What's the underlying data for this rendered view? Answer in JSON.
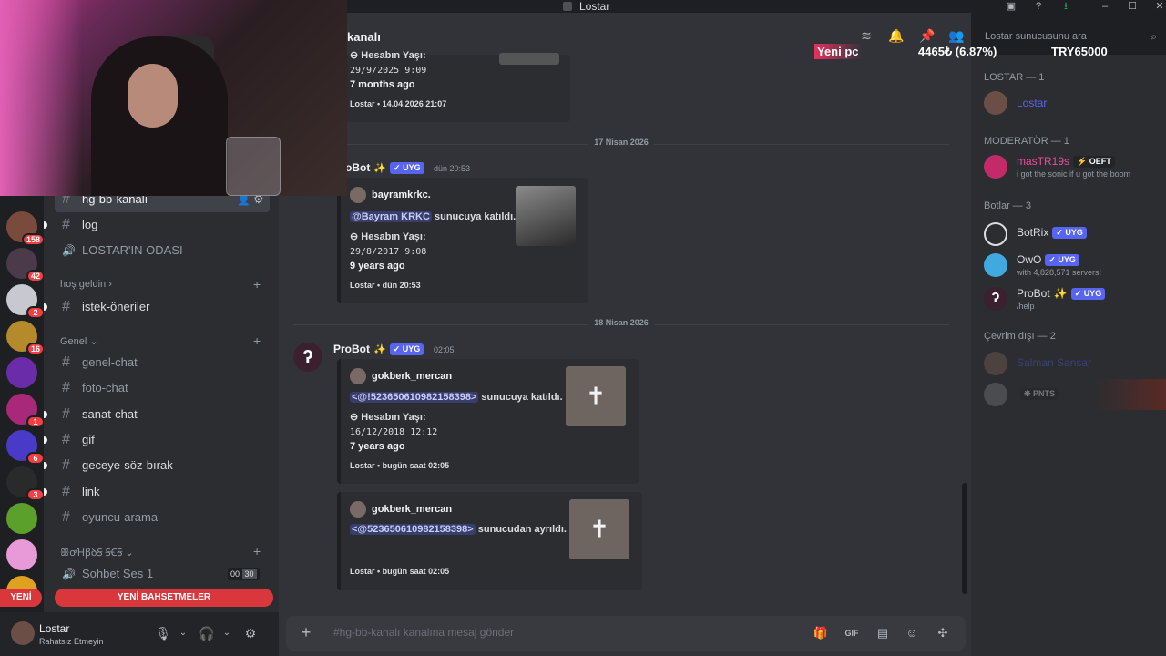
{
  "window": {
    "title": "Lostar"
  },
  "server_rail": {
    "badges": [
      "11",
      "158",
      "42",
      "2",
      "16",
      "1",
      "6",
      "3"
    ]
  },
  "sidebar": {
    "channels_top": [
      {
        "name": "hg-bb-kanalı",
        "type": "text",
        "selected": true
      },
      {
        "name": "log",
        "type": "text"
      },
      {
        "name": "LOSTAR'IN ODASI",
        "type": "voice"
      }
    ],
    "category_welcome": "hoş geldin",
    "channels_welcome": [
      {
        "name": "istek-öneriler",
        "type": "text",
        "unread": true
      }
    ],
    "category_general": "Genel",
    "channels_general": [
      {
        "name": "genel-chat",
        "type": "text",
        "muted": true
      },
      {
        "name": "foto-chat",
        "type": "text",
        "muted": true
      },
      {
        "name": "sanat-chat",
        "type": "text",
        "unread": true
      },
      {
        "name": "gif",
        "type": "text",
        "unread": true
      },
      {
        "name": "geceye-söz-bırak",
        "type": "text",
        "unread": true
      },
      {
        "name": "link",
        "type": "text",
        "unread": true
      },
      {
        "name": "oyuncu-arama",
        "type": "text",
        "muted": true
      }
    ],
    "category_voice": "ꕥꝍꞪꞵꝺꞨ ꞨꞒꞨ",
    "voice_channel": {
      "name": "Sohbet Ses 1",
      "count": "00",
      "limit": "30"
    },
    "new_mentions": "YENİ BAHSETMELER",
    "new_badge": "YENİ"
  },
  "user_panel": {
    "name": "Lostar",
    "status": "Rahatsız Etmeyin"
  },
  "header": {
    "channel": "kanalı",
    "search_placeholder": "Lostar sunucusunu ara"
  },
  "messages": {
    "embed0": {
      "account_age_label": "Hesabın Yaşı:",
      "date": "29/9/2025 9:09",
      "ago": "7 months ago",
      "footer": "Lostar • 14.04.2026 21:07"
    },
    "divider1": "17 Nisan 2026",
    "msg1": {
      "author": "oBot",
      "tag": "UYG",
      "time": "dün 20:53",
      "embed": {
        "user": "bayramkrkc.",
        "mention": "@Bayram KRKC",
        "action": "sunucuya katıldı.",
        "account_age_label": "Hesabın Yaşı:",
        "date": "29/8/2017 9:08",
        "ago": "9 years ago",
        "footer": "Lostar • dün 20:53"
      }
    },
    "divider2": "18 Nisan 2026",
    "msg2": {
      "author": "ProBot",
      "tag": "UYG",
      "time": "02:05",
      "embed": {
        "user": "gokberk_mercan",
        "mention": "<@!523650610982158398>",
        "action": "sunucuya katıldı.",
        "account_age_label": "Hesabın Yaşı:",
        "date": "16/12/2018 12:12",
        "ago": "7 years ago",
        "footer": "Lostar • bugün saat 02:05"
      },
      "embed2": {
        "user": "gokberk_mercan",
        "mention": "<@523650610982158398>",
        "action": "sunucudan ayrıldı.",
        "footer": "Lostar • bugün saat 02:05"
      }
    }
  },
  "composer": {
    "placeholder": "#hg-bb-kanalı kanalına mesaj gönder"
  },
  "members": {
    "cat_lostar": "LOSTAR — 1",
    "lostar": {
      "name": "Lostar"
    },
    "cat_mod": "MODERATÖR — 1",
    "mod": {
      "name": "masTR19s",
      "tag": "OEFT",
      "status": "i got the sonic if u got the boom"
    },
    "cat_bots": "Botlar — 3",
    "bots": [
      {
        "name": "BotRix",
        "tag": "UYG",
        "status": ""
      },
      {
        "name": "OwO",
        "tag": "UYG",
        "status": "with 4,828,571 servers!"
      },
      {
        "name": "ProBot",
        "tag": "UYG",
        "status": "/help"
      }
    ],
    "cat_offline": "Çevrim dışı — 2",
    "offline": [
      {
        "name": "Salman Sansar",
        "tag": ""
      },
      {
        "name": "",
        "tag": "PNTS"
      }
    ]
  },
  "overlay": {
    "label": "Yeni pc",
    "price": "4465₺ (6.87%)",
    "amount": "TRY65000"
  },
  "colors": {
    "accent": "#5865f2",
    "danger": "#da373c",
    "background": "#313338",
    "sidebar": "#2b2d31"
  }
}
